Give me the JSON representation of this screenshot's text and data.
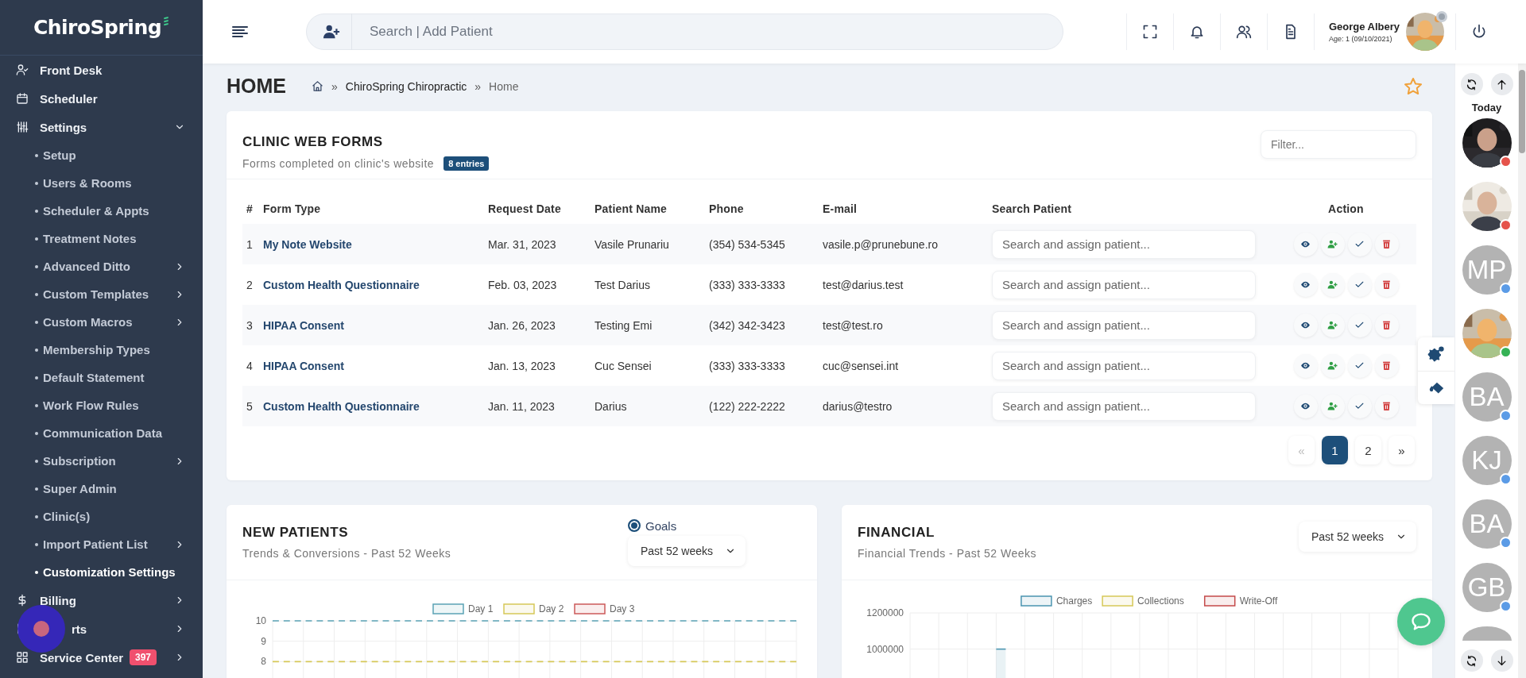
{
  "sidebar": {
    "logo": "ChiroSpring",
    "items": [
      {
        "label": "Front Desk",
        "expandable": false,
        "selected": false
      },
      {
        "label": "Scheduler",
        "expandable": false,
        "selected": false
      },
      {
        "label": "Settings",
        "expandable": true,
        "expanded": true,
        "selected": false,
        "children": [
          {
            "label": "Setup",
            "expandable": false,
            "selected": false
          },
          {
            "label": "Users & Rooms",
            "expandable": false,
            "selected": false
          },
          {
            "label": "Scheduler & Appts",
            "expandable": false,
            "selected": false
          },
          {
            "label": "Treatment Notes",
            "expandable": false,
            "selected": false
          },
          {
            "label": "Advanced Ditto",
            "expandable": true,
            "selected": false
          },
          {
            "label": "Custom Templates",
            "expandable": true,
            "selected": false
          },
          {
            "label": "Custom Macros",
            "expandable": true,
            "selected": false
          },
          {
            "label": "Membership Types",
            "expandable": false,
            "selected": false
          },
          {
            "label": "Default Statement",
            "expandable": false,
            "selected": false
          },
          {
            "label": "Work Flow Rules",
            "expandable": false,
            "selected": false
          },
          {
            "label": "Communication Data",
            "expandable": false,
            "selected": false
          },
          {
            "label": "Subscription",
            "expandable": true,
            "selected": false
          },
          {
            "label": "Super Admin",
            "expandable": false,
            "selected": false
          },
          {
            "label": "Clinic(s)",
            "expandable": false,
            "selected": false
          },
          {
            "label": "Import Patient List",
            "expandable": true,
            "selected": false
          },
          {
            "label": "Customization Settings",
            "expandable": false,
            "selected": true
          }
        ]
      },
      {
        "label": "Billing",
        "expandable": true,
        "expanded": false,
        "selected": false
      },
      {
        "label": "rts",
        "expandable": true,
        "expanded": false,
        "selected": false,
        "click_marker": true
      },
      {
        "label": "Service Center",
        "expandable": true,
        "expanded": false,
        "selected": false,
        "badge": "397"
      }
    ]
  },
  "header": {
    "search": {
      "placeholder": "Search | Add Patient"
    },
    "user": {
      "name": "George Albery",
      "age": "Age: 1 (09/10/2021)"
    }
  },
  "page": {
    "title": "HOME",
    "breadcrumb": [
      {
        "kind": "separator",
        "text": "»"
      },
      {
        "kind": "link",
        "text": "ChiroSpring Chiropractic"
      },
      {
        "kind": "separator",
        "text": "»"
      },
      {
        "kind": "current",
        "text": "Home"
      }
    ],
    "favorite": false
  },
  "web_forms": {
    "title": "CLINIC WEB FORMS",
    "subtitle": "Forms completed on clinic's website",
    "badge": "8 entries",
    "filter": {
      "placeholder": "Filter..."
    },
    "columns": [
      "#",
      "Form Type",
      "Request Date",
      "Patient Name",
      "Phone",
      "E-mail",
      "Search Patient",
      "Action"
    ],
    "rows": [
      {
        "number": "1",
        "form_type": "My Note Website",
        "date": "Mar. 31, 2023",
        "patient": "Vasile Prunariu",
        "phone": "(354) 534-5345",
        "email": "vasile.p@prunebune.ro",
        "search_placeholder": "Search and assign patient..."
      },
      {
        "number": "2",
        "form_type": "Custom Health Questionnaire",
        "date": "Feb. 03, 2023",
        "patient": "Test Darius",
        "phone": "(333) 333-3333",
        "email": "test@darius.test",
        "search_placeholder": "Search and assign patient..."
      },
      {
        "number": "3",
        "form_type": "HIPAA Consent",
        "date": "Jan. 26, 2023",
        "patient": "Testing Emi",
        "phone": "(342) 342-3423",
        "email": "test@test.ro",
        "search_placeholder": "Search and assign patient..."
      },
      {
        "number": "4",
        "form_type": "HIPAA Consent",
        "date": "Jan. 13, 2023",
        "patient": "Cuc Sensei",
        "phone": "(333) 333-3333",
        "email": "cuc@sensei.int",
        "search_placeholder": "Search and assign patient..."
      },
      {
        "number": "5",
        "form_type": "Custom Health Questionnaire",
        "date": "Jan. 11, 2023",
        "patient": "Darius",
        "phone": "(122) 222-2222",
        "email": "darius@testro",
        "search_placeholder": "Search and assign patient..."
      }
    ],
    "pagination": [
      {
        "label": "«",
        "selected": false,
        "disabled": true
      },
      {
        "label": "1",
        "selected": true,
        "disabled": false
      },
      {
        "label": "2",
        "selected": false,
        "disabled": false
      },
      {
        "label": "»",
        "selected": false,
        "disabled": false
      }
    ]
  },
  "new_patients": {
    "title": "NEW PATIENTS",
    "subtitle": "Trends & Conversions - Past 52 Weeks",
    "goals": {
      "label": "Goals",
      "checked": true
    },
    "period": "Past 52 weeks",
    "chart_data": {
      "type": "line",
      "legend": "top",
      "grid": true,
      "ylim": [
        7.2,
        10
      ],
      "yticks": [
        8,
        9,
        10
      ],
      "series": [
        {
          "name": "Day 1",
          "color": "#5ba3b5",
          "line_style": "dashed",
          "values": [
            10,
            10,
            10,
            10,
            10,
            10,
            10,
            10,
            10,
            10,
            10,
            10,
            10,
            10,
            10,
            10,
            10,
            10,
            10,
            10,
            10,
            10,
            10,
            10,
            10,
            10,
            10,
            10,
            10,
            10,
            10,
            10,
            10,
            10,
            10,
            10,
            10,
            10,
            10,
            10,
            10,
            10,
            10,
            10,
            10,
            10,
            10,
            10,
            10,
            10,
            10,
            10
          ]
        },
        {
          "name": "Day 2",
          "color": "#d6c858",
          "line_style": "dashed",
          "values": [
            8,
            8,
            8,
            8,
            8,
            8,
            8,
            8,
            8,
            8,
            8,
            8,
            8,
            8,
            8,
            8,
            8,
            8,
            8,
            8,
            8,
            8,
            8,
            8,
            8,
            8,
            8,
            8,
            8,
            8,
            8,
            8,
            8,
            8,
            8,
            8,
            8,
            8,
            8,
            8,
            8,
            8,
            8,
            8,
            8,
            8,
            8,
            8,
            8,
            8,
            8,
            8
          ]
        },
        {
          "name": "Day 3",
          "color": "#cc5a5a",
          "values": [
            null,
            null,
            null,
            null,
            null,
            null,
            null,
            null,
            null,
            null,
            null,
            null,
            null,
            null,
            null,
            null,
            null,
            null,
            null,
            null,
            null,
            null,
            null,
            null,
            null,
            null,
            null,
            null,
            null,
            null,
            null,
            null,
            null,
            null,
            null,
            null,
            null,
            null,
            null,
            null,
            null,
            null,
            null,
            null,
            null,
            null,
            null,
            null,
            null,
            null,
            null,
            null
          ]
        }
      ]
    }
  },
  "financial": {
    "title": "FINANCIAL",
    "subtitle": "Financial Trends - Past 52 Weeks",
    "period": "Past 52 weeks",
    "chart_data": {
      "type": "area",
      "legend": "top",
      "grid": true,
      "ylim": [
        840000,
        1200000
      ],
      "yticks": [
        1000000,
        1200000
      ],
      "series": [
        {
          "name": "Charges",
          "color": "#4a94b0",
          "values": [
            null,
            null,
            null,
            null,
            null,
            null,
            null,
            null,
            null,
            1000000,
            1000000,
            null,
            null,
            null,
            null,
            null,
            null,
            null,
            null,
            null,
            null,
            null,
            null,
            null,
            null,
            null,
            null,
            null,
            null,
            null,
            null,
            null,
            null,
            null,
            null,
            null,
            null,
            null,
            null,
            null,
            null,
            null,
            null,
            null,
            null,
            null,
            null,
            null,
            null,
            null,
            null,
            null
          ]
        },
        {
          "name": "Collections",
          "color": "#d6c858",
          "values": [
            null,
            null,
            null,
            null,
            null,
            null,
            null,
            null,
            null,
            null,
            null,
            null,
            null,
            null,
            null,
            null,
            null,
            null,
            null,
            null,
            null,
            null,
            null,
            null,
            null,
            null,
            null,
            null,
            null,
            null,
            null,
            null,
            null,
            null,
            null,
            null,
            null,
            null,
            null,
            null,
            null,
            null,
            null,
            null,
            null,
            null,
            null,
            null,
            null,
            null,
            null,
            null
          ]
        },
        {
          "name": "Write-Off",
          "color": "#c44a4a",
          "values": [
            null,
            null,
            null,
            null,
            null,
            null,
            null,
            null,
            null,
            null,
            null,
            null,
            null,
            null,
            null,
            null,
            null,
            null,
            null,
            null,
            null,
            null,
            null,
            null,
            null,
            null,
            null,
            null,
            null,
            null,
            null,
            null,
            null,
            null,
            null,
            null,
            null,
            null,
            null,
            null,
            null,
            null,
            null,
            null,
            null,
            null,
            null,
            null,
            null,
            null,
            null,
            null
          ]
        }
      ]
    }
  },
  "today": {
    "title": "Today",
    "patients": [
      {
        "kind": "picture",
        "color": "#e5534b"
      },
      {
        "kind": "picture",
        "color": "#e5534b"
      },
      {
        "kind": "initials",
        "initials": "MP",
        "color": "#5b9be6"
      },
      {
        "kind": "picture",
        "color": "#35b255"
      },
      {
        "kind": "initials",
        "initials": "BA",
        "color": "#5b9be6"
      },
      {
        "kind": "initials",
        "initials": "KJ",
        "color": "#5b9be6"
      },
      {
        "kind": "initials",
        "initials": "BA",
        "color": "#5b9be6"
      },
      {
        "kind": "initials",
        "initials": "GB",
        "color": "#5b9be6"
      },
      {
        "kind": "blank"
      }
    ]
  }
}
